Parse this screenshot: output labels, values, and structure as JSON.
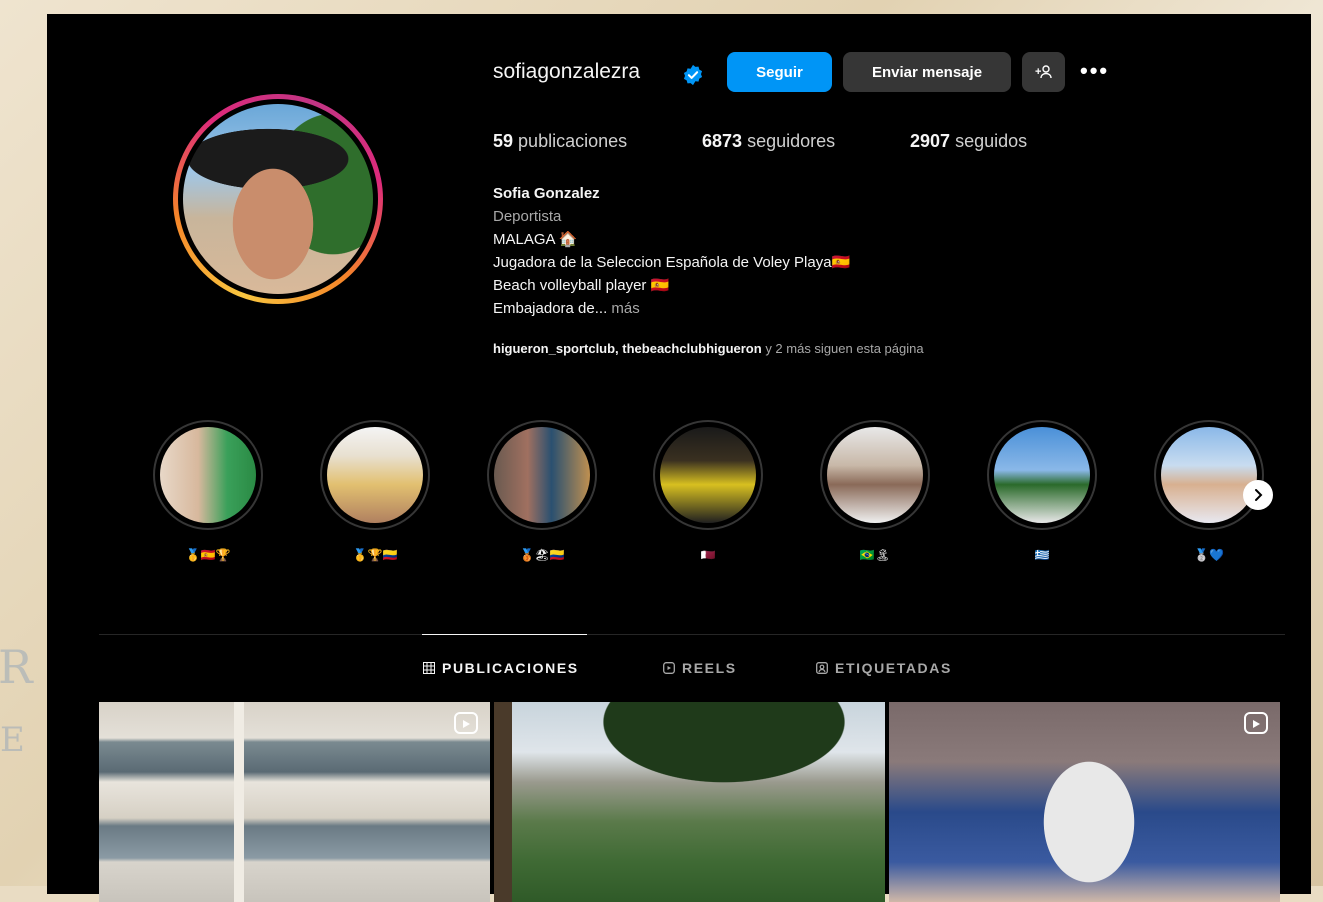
{
  "profile": {
    "username": "sofiagonzalezra",
    "follow_label": "Seguir",
    "message_label": "Enviar mensaje",
    "add_user_label": "+👤",
    "more_label": "•••",
    "stats": [
      {
        "count": "59",
        "label": "publicaciones"
      },
      {
        "count": "6873",
        "label": "seguidores"
      },
      {
        "count": "2907",
        "label": "seguidos"
      }
    ],
    "bio": {
      "name": "Sofia Gonzalez",
      "category": "Deportista",
      "lines": [
        "MALAGA 🏠",
        "Jugadora de la Seleccion Española de Voley Playa🇪🇸",
        "Beach volleyball player 🇪🇸",
        "Embajadora de..."
      ],
      "more_link": "más"
    },
    "followed_by": {
      "accounts": "higueron_sportclub, thebeachclubhigueron",
      "suffix": "y 2 más siguen esta página"
    }
  },
  "highlights": [
    {
      "label": "🥇🇪🇸🏆"
    },
    {
      "label": "🥇🏆🇨🇴"
    },
    {
      "label": "🥉🏖🇨🇴"
    },
    {
      "label": "🇶🇦"
    },
    {
      "label": "🇧🇷🏝"
    },
    {
      "label": "🇬🇷"
    },
    {
      "label": "🥈💙"
    }
  ],
  "tabs": [
    {
      "label": "PUBLICACIONES",
      "icon": "grid-icon"
    },
    {
      "label": "REELS",
      "icon": "reels-icon"
    },
    {
      "label": "ETIQUETADAS",
      "icon": "tagged-icon"
    }
  ],
  "colors": {
    "accent": "#0095f6",
    "background": "#000000",
    "button_secondary": "#363636"
  }
}
